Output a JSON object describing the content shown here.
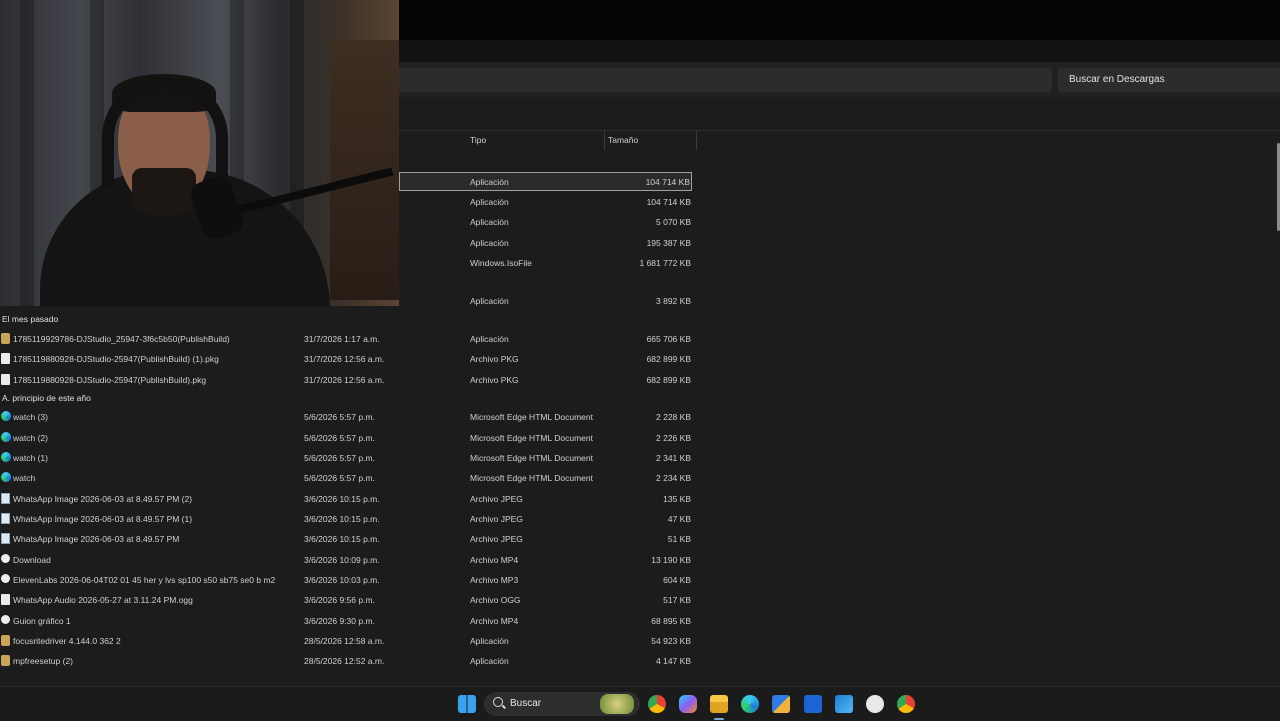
{
  "search": {
    "placeholder": "Buscar en Descargas"
  },
  "columns": {
    "type": "Tipo",
    "size": "Tamaño"
  },
  "top_rows": [
    {
      "type": "Aplicación",
      "size": "104 714 KB",
      "selected": true
    },
    {
      "type": "Aplicación",
      "size": "104 714 KB"
    },
    {
      "type": "Aplicación",
      "size": "5 070 KB"
    },
    {
      "type": "Aplicación",
      "size": "195 387 KB"
    },
    {
      "type": "Windows.IsoFile",
      "size": "1 681 772 KB"
    },
    {
      "type": "Aplicación",
      "size": "3 892 KB"
    }
  ],
  "groups": {
    "last_month": "El mes pasado",
    "this_year": "A. principio de este año"
  },
  "last_month_rows": [
    {
      "icon": "app-icon",
      "name": "1785119929786-DJStudio_25947-3f6c5b50(PublishBuild)",
      "date": "31/7/2026 1:17 a.m.",
      "type": "Aplicación",
      "size": "665 706 KB"
    },
    {
      "icon": "file-icon",
      "name": "1785119880928-DJStudio-25947(PublishBuild) (1).pkg",
      "date": "31/7/2026 12:56 a.m.",
      "type": "Archivo PKG",
      "size": "682 899 KB"
    },
    {
      "icon": "file-icon",
      "name": "1785119880928-DJStudio-25947(PublishBuild).pkg",
      "date": "31/7/2026 12:56 a.m.",
      "type": "Archivo PKG",
      "size": "682 899 KB"
    }
  ],
  "this_year_rows": [
    {
      "icon": "edge-icon",
      "name": "watch (3)",
      "date": "5/6/2026 5:57 p.m.",
      "type": "Microsoft Edge HTML Document",
      "size": "2 228 KB"
    },
    {
      "icon": "edge-icon",
      "name": "watch (2)",
      "date": "5/6/2026 5:57 p.m.",
      "type": "Microsoft Edge HTML Document",
      "size": "2 226 KB"
    },
    {
      "icon": "edge-icon",
      "name": "watch (1)",
      "date": "5/6/2026 5:57 p.m.",
      "type": "Microsoft Edge HTML Document",
      "size": "2 341 KB"
    },
    {
      "icon": "edge-icon",
      "name": "watch",
      "date": "5/6/2026 5:57 p.m.",
      "type": "Microsoft Edge HTML Document",
      "size": "2 234 KB"
    },
    {
      "icon": "image-icon",
      "name": "WhatsApp Image 2026-06-03 at 8.49.57 PM (2)",
      "date": "3/6/2026 10:15 p.m.",
      "type": "Archivo JPEG",
      "size": "135 KB"
    },
    {
      "icon": "image-icon",
      "name": "WhatsApp Image 2026-06-03 at 8.49.57 PM (1)",
      "date": "3/6/2026 10:15 p.m.",
      "type": "Archivo JPEG",
      "size": "47 KB"
    },
    {
      "icon": "image-icon",
      "name": "WhatsApp Image 2026-06-03 at 8.49.57 PM",
      "date": "3/6/2026 10:15 p.m.",
      "type": "Archivo JPEG",
      "size": "51 KB"
    },
    {
      "icon": "video-icon",
      "name": "Download",
      "date": "3/6/2026 10:09 p.m.",
      "type": "Archivo MP4",
      "size": "13 190 KB"
    },
    {
      "icon": "video-icon",
      "name": "ElevenLabs 2026-06-04T02 01 45 her y lvs sp100 s50 sb75 se0 b m2",
      "date": "3/6/2026 10:03 p.m.",
      "type": "Archivo MP3",
      "size": "604 KB"
    },
    {
      "icon": "file-icon",
      "name": "WhatsApp Audio 2026-05-27 at 3.11.24 PM.ogg",
      "date": "3/6/2026 9:56 p.m.",
      "type": "Archivo OGG",
      "size": "517 KB"
    },
    {
      "icon": "video-icon",
      "name": "Guion gráfico 1",
      "date": "3/6/2026 9:30 p.m.",
      "type": "Archivo MP4",
      "size": "68 895 KB"
    },
    {
      "icon": "app-icon",
      "name": "focusritedriver 4.144.0 362 2",
      "date": "28/5/2026 12:58 a.m.",
      "type": "Aplicación",
      "size": "54 923 KB"
    },
    {
      "icon": "app-icon",
      "name": "mpfreesetup (2)",
      "date": "28/5/2026 12:52 a.m.",
      "type": "Aplicación",
      "size": "4 147 KB"
    }
  ],
  "taskbar": {
    "search_label": "Buscar",
    "icons": [
      "windows-start-icon",
      "chrome-icon",
      "copilot-icon",
      "file-explorer-icon",
      "edge-icon",
      "microsoft-store-icon",
      "app-icon",
      "outlook-icon",
      "notification-app-icon",
      "chrome-profile-icon"
    ]
  }
}
